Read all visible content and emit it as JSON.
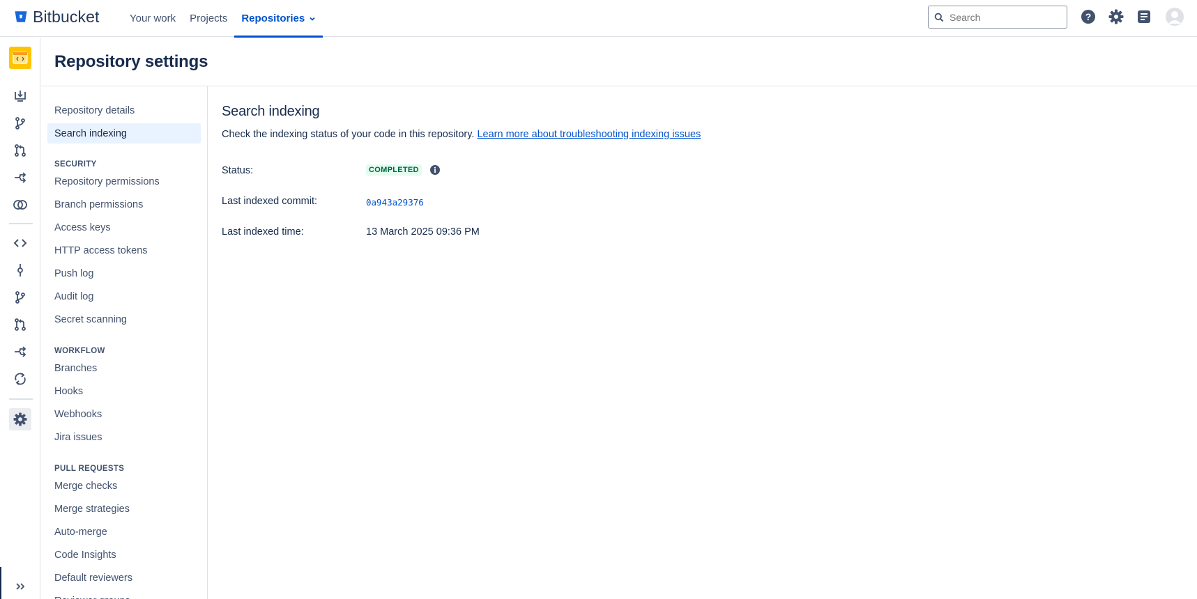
{
  "topnav": {
    "brand": "Bitbucket",
    "links": [
      "Your work",
      "Projects",
      "Repositories"
    ],
    "active_link": "Repositories",
    "search_placeholder": "Search",
    "icons": [
      "help-icon",
      "settings-icon",
      "notes-icon",
      "user-avatar"
    ]
  },
  "rail": {
    "repo_avatar_color": "#ffc400",
    "icons": [
      "clone-icon",
      "create-branch-icon",
      "create-pull-request-icon",
      "fork-icon",
      "compare-icon",
      "source-icon",
      "commits-icon",
      "branches-icon",
      "pull-requests-icon",
      "forks-icon",
      "sync-icon",
      "settings-icon"
    ],
    "selected": "settings-icon"
  },
  "page": {
    "title": "Repository settings"
  },
  "settings_nav": {
    "top_items": [
      "Repository details",
      "Search indexing"
    ],
    "selected": "Search indexing",
    "sections": [
      {
        "heading": "SECURITY",
        "items": [
          "Repository permissions",
          "Branch permissions",
          "Access keys",
          "HTTP access tokens",
          "Push log",
          "Audit log",
          "Secret scanning"
        ]
      },
      {
        "heading": "WORKFLOW",
        "items": [
          "Branches",
          "Hooks",
          "Webhooks",
          "Jira issues"
        ]
      },
      {
        "heading": "PULL REQUESTS",
        "items": [
          "Merge checks",
          "Merge strategies",
          "Auto-merge",
          "Code Insights",
          "Default reviewers",
          "Reviewer groups"
        ]
      }
    ]
  },
  "main": {
    "heading": "Search indexing",
    "description": "Check the indexing status of your code in this repository.",
    "link_text": "Learn more about troubleshooting indexing issues",
    "status_label": "Status:",
    "status_value": "COMPLETED",
    "commit_label": "Last indexed commit:",
    "commit_value": "0a943a29376",
    "time_label": "Last indexed time:",
    "time_value": "13 March 2025 09:36 PM"
  },
  "colors": {
    "accent": "#0052cc",
    "text": "#172b4d",
    "muted": "#42526e",
    "status_bg": "#e3fcef",
    "status_text": "#006644",
    "selected_bg": "#e9f2ff"
  }
}
